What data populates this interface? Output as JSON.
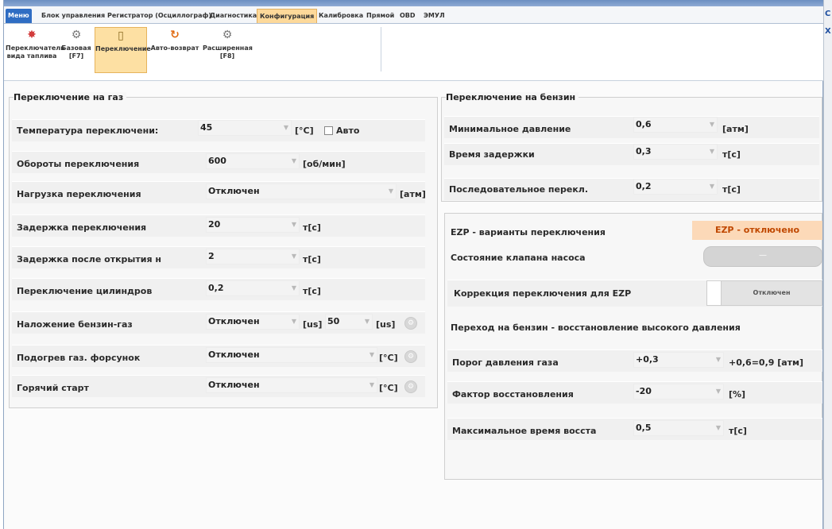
{
  "tabs": [
    "Меню",
    "Блок управления",
    "Регистратор (Осциллограф)",
    "Диагностика",
    "Конфигурация",
    "Калибровка",
    "Прямой",
    "OBD",
    "ЭМУЛ"
  ],
  "ribbon": {
    "fuel_switch": "Переключатель вида таплива",
    "basic": "Базовая",
    "basic_key": "[F7]",
    "switching": "Переключение",
    "auto_return": "Авто-возврат",
    "extended": "Расширенная",
    "extended_key": "[F8]"
  },
  "gas": {
    "title": "Переключение на газ",
    "temp_label": "Температура переключени:",
    "temp_value": "45",
    "temp_unit": "[°C]",
    "auto_label": "Авто",
    "rpm_label": "Обороты переключения",
    "rpm_value": "600",
    "rpm_unit": "[об/мин]",
    "load_label": "Нагрузка переключения",
    "load_value": "Отключен",
    "load_unit": "[атм]",
    "delay_label": "Задержка переключения",
    "delay_value": "20",
    "delay_unit": "т[с]",
    "open_delay_label": "Задержка после открытия н",
    "open_delay_value": "2",
    "open_delay_unit": "т[с]",
    "cyl_label": "Переключение цилиндров",
    "cyl_value": "0,2",
    "cyl_unit": "т[с]",
    "overlap_label": "Наложение бензин-газ",
    "overlap_value": "Отключен",
    "overlap_unit": "[us]",
    "overlap_value2": "50",
    "overlap_unit2": "[us]",
    "heat_label": "Подогрев газ. форсунок",
    "heat_value": "Отключен",
    "heat_unit": "[°C]",
    "hot_label": "Горячий старт",
    "hot_value": "Отключен",
    "hot_unit": "[°C]"
  },
  "petrol": {
    "title": "Переключение на бензин",
    "minp_label": "Минимальное давление",
    "minp_value": "0,6",
    "minp_unit": "[атм]",
    "delay_label": "Время задержки",
    "delay_value": "0,3",
    "delay_unit": "т[с]",
    "seq_label": "Последовательное перекл.",
    "seq_value": "0,2",
    "seq_unit": "т[с]"
  },
  "ezp": {
    "title": "EZP - варианты переключения",
    "status": "EZP - отключено",
    "pump_label": "Состояние клапана насоса",
    "pump_value": "—",
    "corr_label": "Коррекция переключения для EZP",
    "corr_value": "Отключен",
    "recovery_title": "Переход на бензин - восстановление высокого давления",
    "thr_label": "Порог давления газа",
    "thr_value": "+0,3",
    "thr_result": "+0,6=0,9 [атм]",
    "factor_label": "Фактор восстановления",
    "factor_value": "-20",
    "factor_unit": "[%]",
    "maxt_label": "Максимальное время восста",
    "maxt_value": "0,5",
    "maxt_unit": "т[с]"
  },
  "side": [
    "С",
    "Х"
  ]
}
